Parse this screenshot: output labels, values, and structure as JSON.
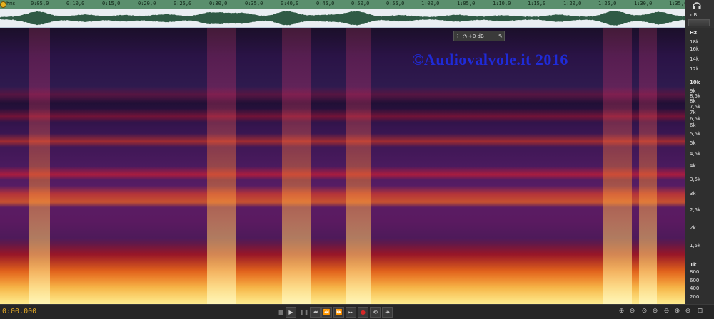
{
  "timeline": {
    "start_label": "hms",
    "labels": [
      "0:05,0",
      "0:10,0",
      "0:15,0",
      "0:20,0",
      "0:25,0",
      "0:30,0",
      "0:35,0",
      "0:40,0",
      "0:45,0",
      "0:50,0",
      "0:55,0",
      "1:00,0",
      "1:05,0",
      "1:10,0",
      "1:15,0",
      "1:20,0",
      "1:25,0",
      "1:30,0",
      "1:35,0"
    ]
  },
  "side": {
    "db_label": "dB",
    "headphone_icon": "headphones-icon"
  },
  "hud": {
    "gain": "+0 dB"
  },
  "watermark": "©Audiovalvole.it 2016",
  "frequency_scale": {
    "unit": "Hz",
    "labels": [
      "18k",
      "16k",
      "14k",
      "12k",
      "10k",
      "9k",
      "8,5k",
      "8k",
      "7,5k",
      "7k",
      "6,5k",
      "6k",
      "5,5k",
      "5k",
      "4,5k",
      "4k",
      "3,5k",
      "3k",
      "2,5k",
      "2k",
      "1,5k",
      "1k",
      "800",
      "600",
      "400",
      "200"
    ]
  },
  "transport": {
    "timecode": "0:00.000",
    "buttons": [
      "stop",
      "play",
      "pause",
      "go-to-start",
      "rewind",
      "fast-forward",
      "go-to-end",
      "record",
      "loop",
      "skip-selection"
    ]
  },
  "zoom_tools": [
    "zoom-in-amplitude",
    "zoom-out-amplitude",
    "zoom-full",
    "zoom-in-time",
    "zoom-out-time",
    "zoom-in-frequency",
    "zoom-out-frequency",
    "zoom-fit"
  ],
  "colors": {
    "accent": "#e2a826",
    "ruler": "#5a8f6d",
    "watermark": "#1f2bd8"
  }
}
